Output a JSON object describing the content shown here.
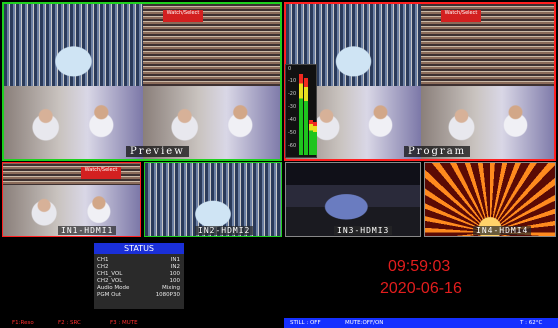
{
  "preview": {
    "label": "Preview"
  },
  "program": {
    "label": "Program"
  },
  "inputs": [
    {
      "label": "IN1-HDMI1"
    },
    {
      "label": "IN2-HDMI2"
    },
    {
      "label": "IN3-HDMI3"
    },
    {
      "label": "IN4-HDMI4"
    }
  ],
  "banner_text": "Watch/Select",
  "audio_meter": {
    "ticks": [
      "0",
      "-10",
      "-20",
      "-30",
      "-40",
      "-50",
      "-60"
    ],
    "levels": [
      0.92,
      0.88,
      0.4,
      0.38
    ]
  },
  "status": {
    "title": "STATUS",
    "rows": [
      {
        "key": "CH1",
        "value": "IN1"
      },
      {
        "key": "CH2",
        "value": "IN2"
      },
      {
        "key": "CH1_VOL",
        "value": "100"
      },
      {
        "key": "CH2_VOL",
        "value": "100"
      },
      {
        "key": "Audio Mode",
        "value": "Mixing"
      },
      {
        "key": "PGM Out",
        "value": "1080P30"
      }
    ]
  },
  "clock": {
    "time": "09:59:03",
    "date": "2020-06-16"
  },
  "footer": {
    "f1": "F1:Reso",
    "f2": "F2 : SRC",
    "f3": "F3 : MUTE",
    "still": "STILL : OFF",
    "mute": "MUTE:OFF/ON",
    "temp": "T : 62°C"
  },
  "colors": {
    "preview_border": "#1fd11f",
    "program_border": "#ff2020",
    "status_header": "#1a2fd8",
    "clock": "#e21d1d",
    "footer_label": "#ff3030",
    "status_bar": "#1530ff"
  }
}
